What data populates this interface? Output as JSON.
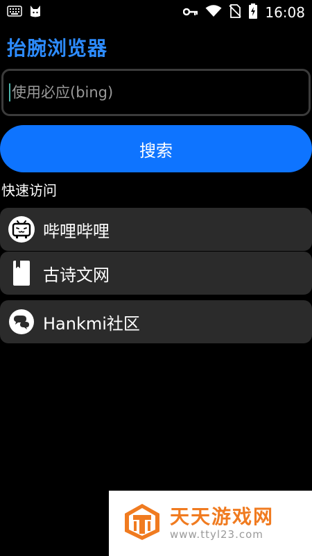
{
  "status_bar": {
    "time": "16:08",
    "left_icons": [
      "keyboard-icon",
      "cat-icon"
    ],
    "right_icons": [
      "key-icon",
      "wifi-icon",
      "no-sim-icon",
      "battery-charging-icon"
    ]
  },
  "app": {
    "title": "抬腕浏览器"
  },
  "search": {
    "placeholder": "使用必应(bing)",
    "value": "",
    "button_label": "搜索"
  },
  "quick_access": {
    "title": "快速访问",
    "items": [
      {
        "label": "哔哩哔哩",
        "icon": "bilibili-tv-icon"
      },
      {
        "label": "古诗文网",
        "icon": "book-icon"
      },
      {
        "label": "Hankmi社区",
        "icon": "chat-bubbles-icon"
      }
    ]
  },
  "watermark": {
    "title": "天天游戏网",
    "url": "www.ttyl23.com",
    "logo_letter": "T",
    "brand_color": "#f07b20"
  },
  "colors": {
    "accent": "#0e74ff",
    "title": "#2d8cff",
    "item_bg": "#2b2b2b",
    "background": "#000000"
  }
}
